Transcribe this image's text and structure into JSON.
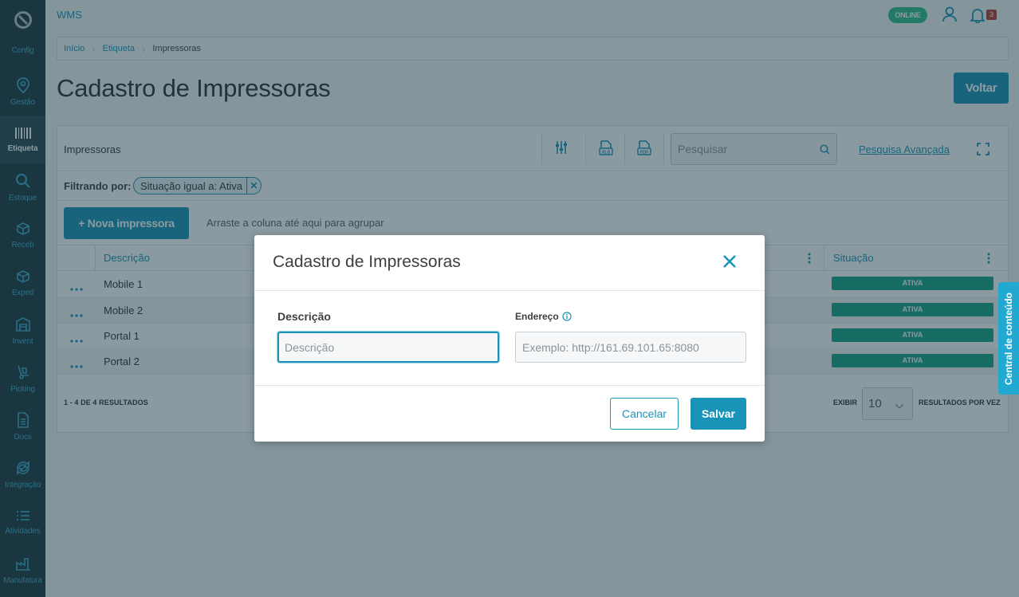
{
  "sidebar": {
    "items": [
      {
        "label": "Config",
        "icon": "config-icon"
      },
      {
        "label": "Gestão",
        "icon": "location-pin-icon"
      },
      {
        "label": "Etiqueta",
        "icon": "barcode-icon",
        "active": true
      },
      {
        "label": "Estoque",
        "icon": "search-icon"
      },
      {
        "label": "Receb",
        "icon": "box-icon"
      },
      {
        "label": "Exped",
        "icon": "box-icon"
      },
      {
        "label": "Invent",
        "icon": "warehouse-icon"
      },
      {
        "label": "Picking",
        "icon": "dolly-icon"
      },
      {
        "label": "Docs",
        "icon": "document-icon"
      },
      {
        "label": "Integração",
        "icon": "sync-icon"
      },
      {
        "label": "Atividades",
        "icon": "list-icon"
      },
      {
        "label": "Manufatura",
        "icon": "factory-icon"
      }
    ]
  },
  "header": {
    "app_name": "WMS",
    "status": "ONLINE",
    "notifications": "3"
  },
  "breadcrumb": [
    "Início",
    "Etiqueta",
    "Impressoras"
  ],
  "page": {
    "title": "Cadastro de Impressoras",
    "back_label": "Voltar"
  },
  "grid": {
    "title": "Impressoras",
    "search_placeholder": "Pesquisar",
    "advanced_search": "Pesquisa Avançada",
    "filter_label": "Filtrando por:",
    "filter_chip": "Situação igual a: Ativa",
    "new_button": "+ Nova impressora",
    "group_hint": "Arraste a coluna até aqui para agrupar",
    "columns": [
      "Descrição",
      "Situação"
    ],
    "rows": [
      {
        "descricao": "Mobile 1",
        "situacao": "ATIVA"
      },
      {
        "descricao": "Mobile 2",
        "situacao": "ATIVA"
      },
      {
        "descricao": "Portal 1",
        "situacao": "ATIVA"
      },
      {
        "descricao": "Portal 2",
        "situacao": "ATIVA"
      }
    ],
    "results_count": "1 - 4 DE 4 RESULTADOS",
    "show_label": "EXIBIR",
    "page_size": "10",
    "per_page_label": "RESULTADOS POR VEZ"
  },
  "side_tab": "Central de conteúdo",
  "modal": {
    "title": "Cadastro de Impressoras",
    "field1_label": "Descrição",
    "field1_placeholder": "Descrição",
    "field2_label": "Endereço",
    "field2_placeholder": "Exemplo: http://161.69.101.65:8080",
    "cancel": "Cancelar",
    "save": "Salvar"
  },
  "colors": {
    "accent": "#1a93b8",
    "sidebar": "#1d3640",
    "status_active": "#18a287",
    "online": "#2fbd8a"
  }
}
